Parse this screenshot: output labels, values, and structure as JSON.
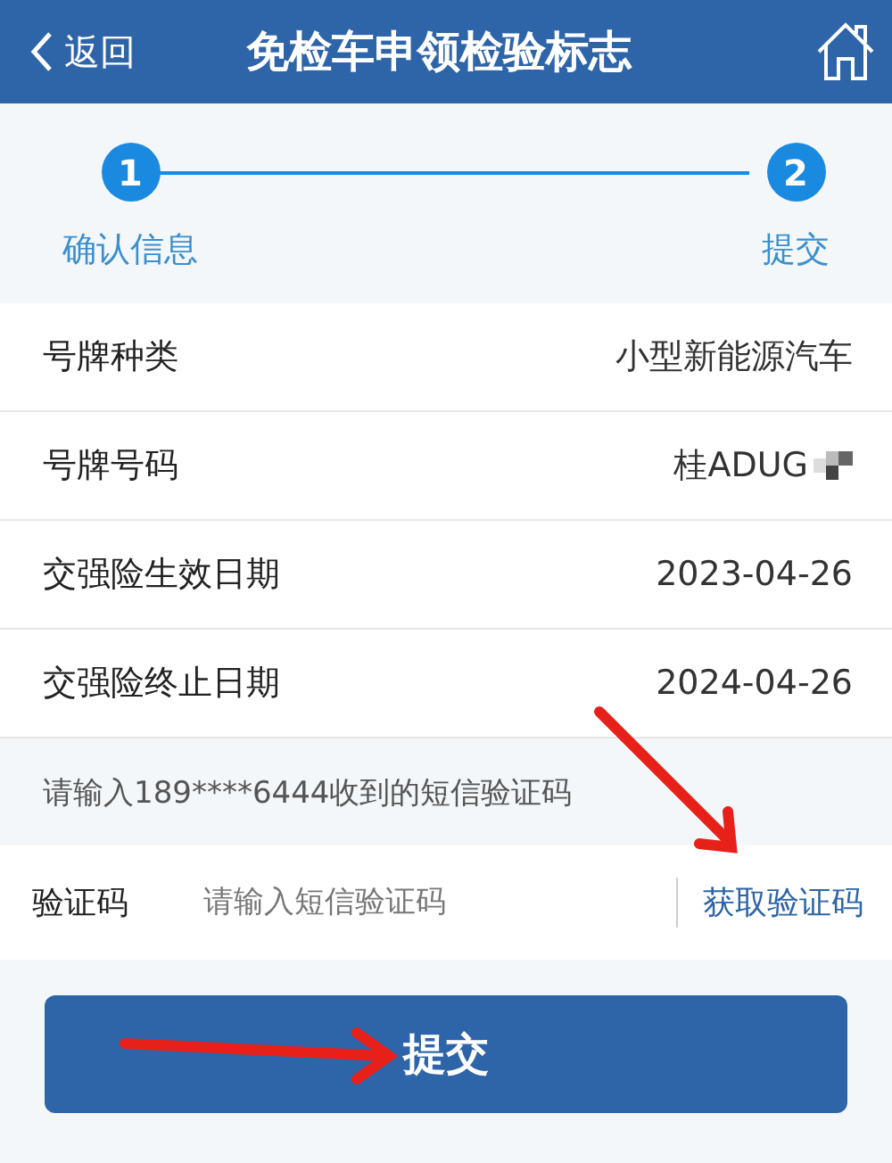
{
  "header": {
    "back": "返回",
    "title": "免检车申领检验标志"
  },
  "steps": [
    {
      "number": "1",
      "label": "确认信息"
    },
    {
      "number": "2",
      "label": "提交"
    }
  ],
  "fields": [
    {
      "label": "号牌种类",
      "value": "小型新能源汽车",
      "redacted": false
    },
    {
      "label": "号牌号码",
      "value": "桂ADUG",
      "redacted": true
    },
    {
      "label": "交强险生效日期",
      "value": "2023-04-26",
      "redacted": false
    },
    {
      "label": "交强险终止日期",
      "value": "2024-04-26",
      "redacted": false
    }
  ],
  "sms_hint": "请输入189****6444收到的短信验证码",
  "code_field": {
    "label": "验证码",
    "placeholder": "请输入短信验证码",
    "action": "获取验证码"
  },
  "submit": "提交"
}
